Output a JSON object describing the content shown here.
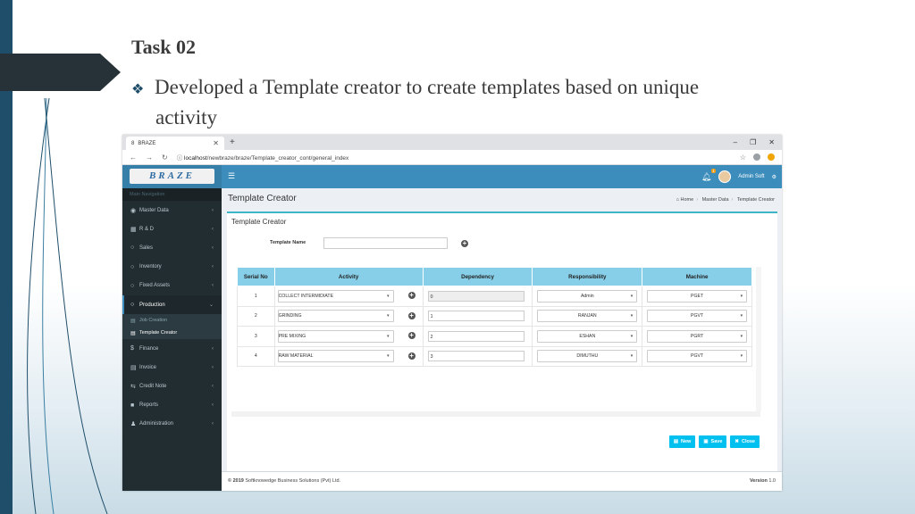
{
  "slide": {
    "title": "Task 02",
    "bullet_line1": "Developed a Template creator to create templates based on unique",
    "bullet_line2": "activity"
  },
  "browser": {
    "tab_title": "BRAZE",
    "url_host": "localhost",
    "url_path": "/newbraze/braze/Template_creator_cont/general_index"
  },
  "app": {
    "logo_text": "BRAZE",
    "notification_count": "1",
    "user_name": "Admin Soft",
    "sidebar": {
      "header": "Main Navigation",
      "items": [
        {
          "label": "Master Data",
          "icon": "dashboard-icon"
        },
        {
          "label": "R & D",
          "icon": "grid-icon"
        },
        {
          "label": "Sales",
          "icon": "circle-icon"
        },
        {
          "label": "Inventory",
          "icon": "circle-icon"
        },
        {
          "label": "Fixed Assets",
          "icon": "circle-icon"
        },
        {
          "label": "Production",
          "icon": "circle-icon"
        },
        {
          "label": "Finance",
          "icon": "dollar-icon"
        },
        {
          "label": "Invoice",
          "icon": "file-icon"
        },
        {
          "label": "Credit Note",
          "icon": "exchange-icon"
        },
        {
          "label": "Reports",
          "icon": "folder-icon"
        },
        {
          "label": "Administration",
          "icon": "user-icon"
        }
      ],
      "sub_items": [
        {
          "label": "Job Creation"
        },
        {
          "label": "Template Creator"
        }
      ]
    },
    "page_title": "Template Creator",
    "breadcrumb": {
      "home": "Home",
      "mid": "Master Data",
      "current": "Template Creator"
    },
    "box_title": "Template Creator",
    "template_name_label": "Template Name",
    "template_name_value": "",
    "table": {
      "headers": [
        "Serial No",
        "Activity",
        "Dependency",
        "Responsibility",
        "Machine"
      ],
      "rows": [
        {
          "serial": "1",
          "activity": "COLLECT INTERMIDIATE",
          "dependency": "0",
          "responsibility": "Admin",
          "machine": "PGET"
        },
        {
          "serial": "2",
          "activity": "GRINDING",
          "dependency": "1",
          "responsibility": "RANJAN",
          "machine": "PGVT"
        },
        {
          "serial": "3",
          "activity": "PRE MIXING",
          "dependency": "2",
          "responsibility": "ESHAN",
          "machine": "PGRT"
        },
        {
          "serial": "4",
          "activity": "RAW MATERIAL",
          "dependency": "3",
          "responsibility": "DIMUTHU",
          "machine": "PGVT"
        }
      ]
    },
    "buttons": {
      "new": "New",
      "save": "Save",
      "close": "Close"
    },
    "footer": {
      "copyright_year": "© 2019",
      "copyright_text": "Softknowedge Business Solutions (Pvt) Ltd.",
      "version_label": "Version",
      "version": "1.0"
    }
  },
  "colors": {
    "header_blue": "#3c8dbc",
    "sidebar_dark": "#222d32",
    "table_header": "#87cfe8",
    "button_cyan": "#00c0ef"
  }
}
